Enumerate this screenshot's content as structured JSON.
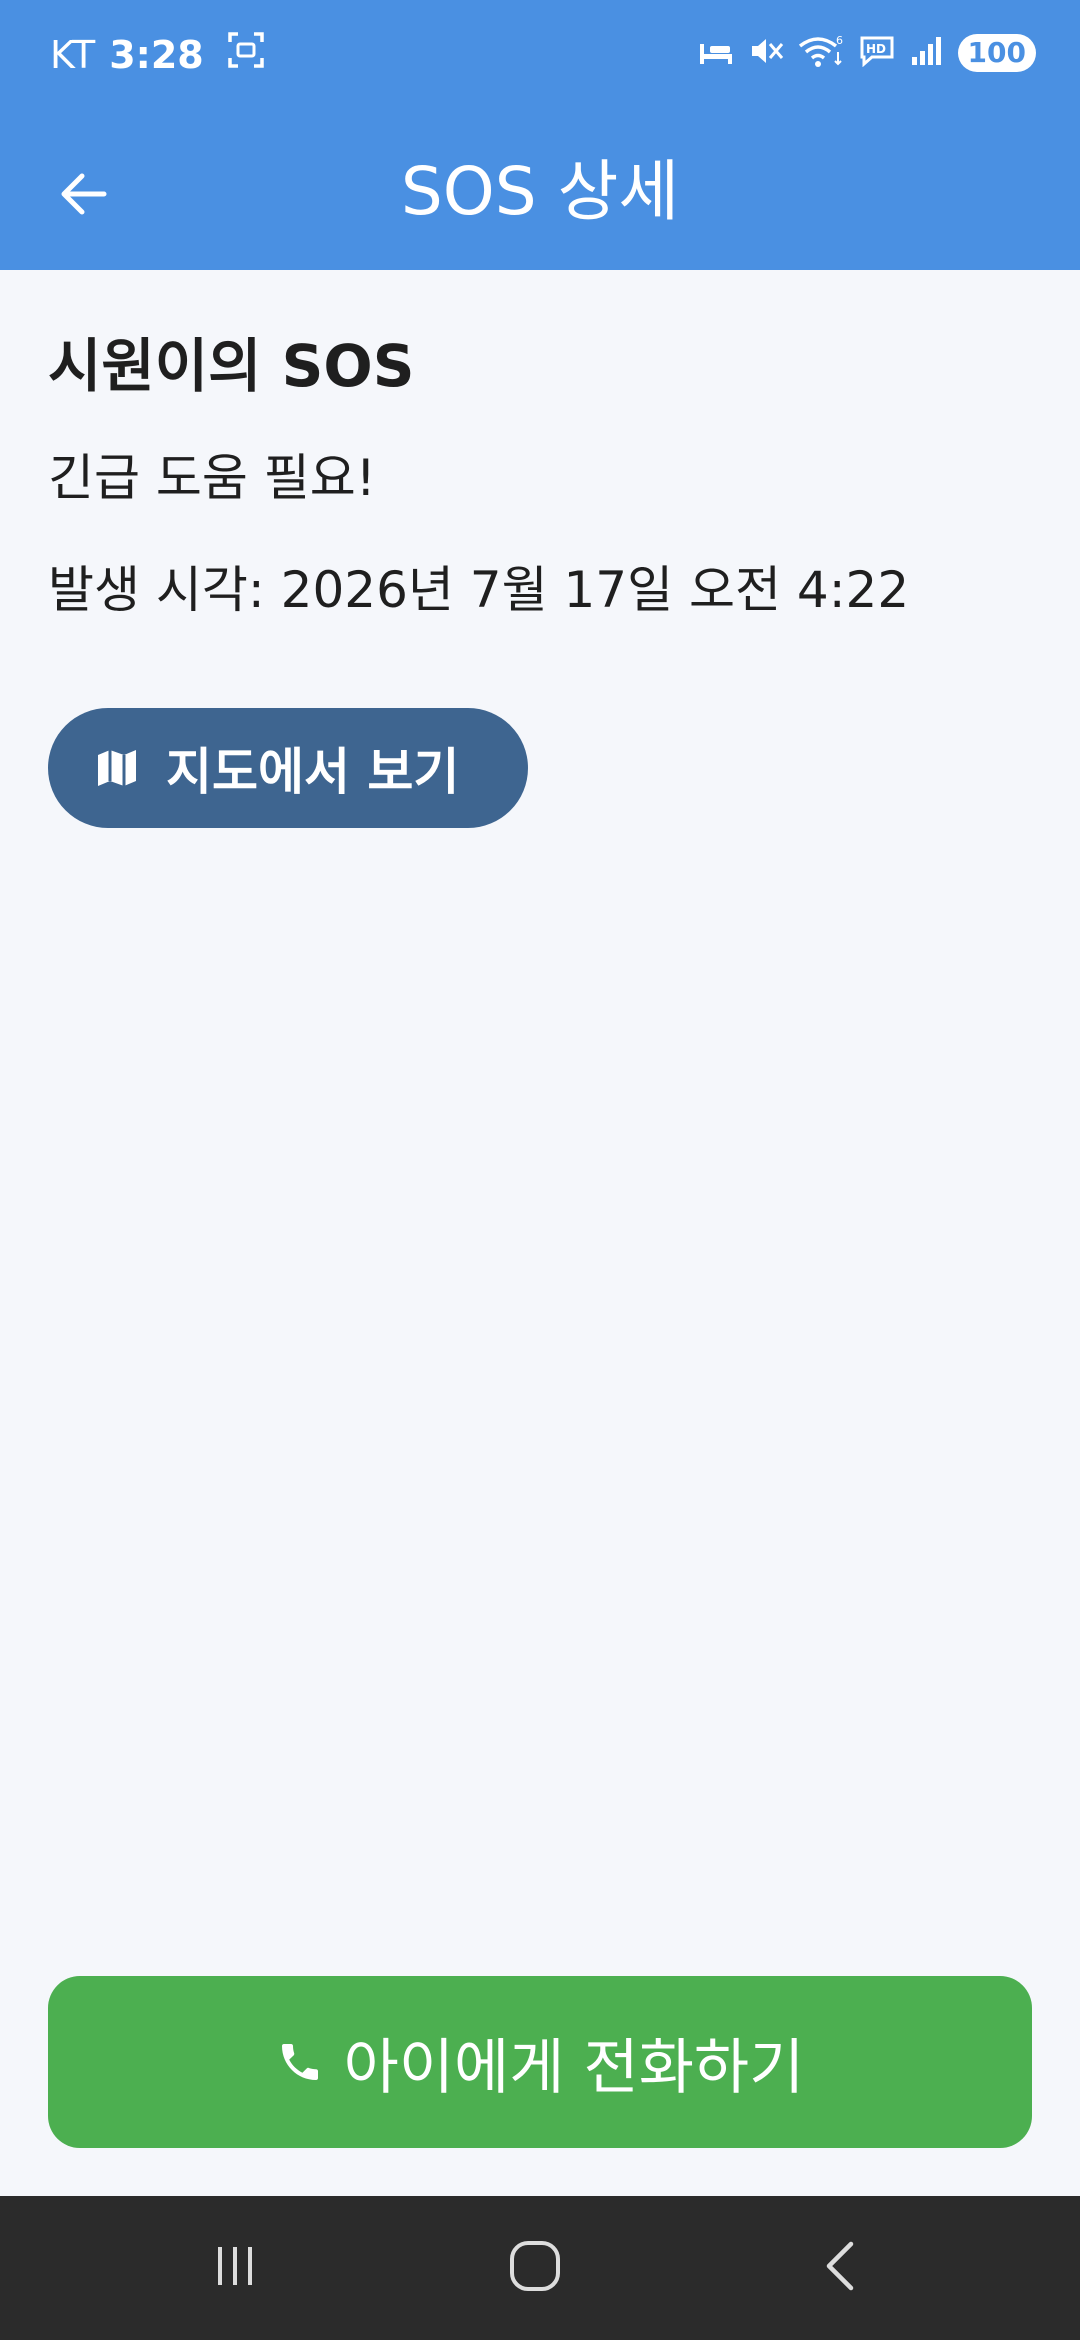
{
  "status_bar": {
    "carrier": "KT",
    "time": "3:28",
    "battery": "100",
    "icons": [
      "screenshot-icon",
      "sleep-icon",
      "mute-icon",
      "wifi-icon",
      "hd-icon",
      "signal-icon"
    ]
  },
  "app_bar": {
    "title": "SOS 상세",
    "back_icon": "arrow-back-icon"
  },
  "detail": {
    "title": "시원이의 SOS",
    "message": "긴급 도움 필요!",
    "time_text": "발생 시각: 2026년 7월 17일 오전 4:22"
  },
  "map_button": {
    "label": "지도에서 보기",
    "icon": "map-icon"
  },
  "call_button": {
    "label": "아이에게 전화하기",
    "icon": "phone-icon"
  },
  "nav_bar": {
    "buttons": [
      "recent-apps-icon",
      "home-icon",
      "back-icon"
    ]
  },
  "colors": {
    "primary": "#4A90E2",
    "map_button": "#3E6590",
    "call_button": "#4CAF50",
    "background": "#F5F7FB",
    "nav_bar": "#2B2B2B"
  }
}
